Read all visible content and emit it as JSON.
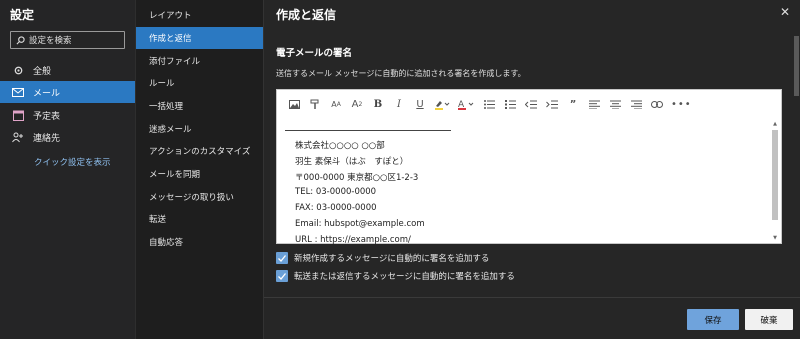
{
  "settings_title": "設定",
  "search": {
    "placeholder": "設定を検索"
  },
  "nav": {
    "items": [
      {
        "label": "全般",
        "icon": "gear-icon"
      },
      {
        "label": "メール",
        "icon": "mail-icon",
        "active": true
      },
      {
        "label": "予定表",
        "icon": "calendar-icon"
      },
      {
        "label": "連絡先",
        "icon": "people-icon"
      }
    ],
    "quick_settings": "クイック設定を表示"
  },
  "subnav": {
    "items": [
      {
        "label": "レイアウト"
      },
      {
        "label": "作成と返信",
        "active": true
      },
      {
        "label": "添付ファイル"
      },
      {
        "label": "ルール"
      },
      {
        "label": "一括処理"
      },
      {
        "label": "迷惑メール"
      },
      {
        "label": "アクションのカスタマイズ"
      },
      {
        "label": "メールを同期"
      },
      {
        "label": "メッセージの取り扱い"
      },
      {
        "label": "転送"
      },
      {
        "label": "自動応答"
      }
    ]
  },
  "main": {
    "title": "作成と返信",
    "close_glyph": "✕",
    "signature_heading": "電子メールの署名",
    "signature_description": "送信するメール メッセージに自動的に追加される署名を作成します。",
    "signature_lines": [
      "株式会社○○○○ ○○部",
      "羽生 素保斗（はぶ　すぽと）",
      "〒000-0000 東京都○○区1-2-3",
      "TEL: 03-0000-0000",
      "FAX: 03-0000-0000",
      "Email: hubspot@example.com",
      "URL : https://example.com/"
    ],
    "checkboxes": [
      {
        "label": "新規作成するメッセージに自動的に署名を追加する",
        "checked": true
      },
      {
        "label": "転送または返信するメッセージに自動的に署名を追加する",
        "checked": true
      }
    ],
    "save_label": "保存",
    "discard_label": "破棄"
  },
  "toolbar": {
    "icons": [
      "image-icon",
      "format-painter-icon",
      "font-size-icon",
      "superscript-icon",
      "bold-icon",
      "italic-icon",
      "underline-icon",
      "highlight-icon",
      "font-color-icon",
      "bullets-icon",
      "numbering-icon",
      "decrease-indent-icon",
      "increase-indent-icon",
      "quote-icon",
      "align-left-icon",
      "align-center-icon",
      "align-right-icon",
      "link-icon",
      "more-icon"
    ]
  },
  "colors": {
    "accent": "#2b79c2",
    "button_primary": "#6fa3dc",
    "highlight": "#f3d23c",
    "font_color": "#d9363e"
  }
}
